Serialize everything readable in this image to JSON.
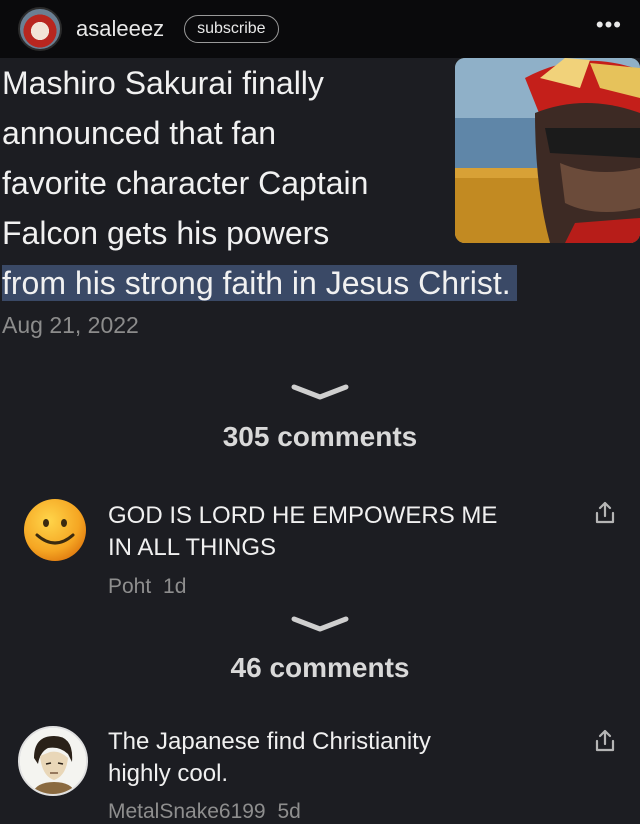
{
  "header": {
    "username": "asaleeez",
    "subscribe_label": "subscribe",
    "more_label": "•••"
  },
  "post": {
    "lines": [
      "Mashiro Sakurai finally",
      "announced that fan",
      "favorite character Captain",
      "Falcon gets his powers",
      "from his strong faith in Jesus Christ."
    ],
    "date": "Aug 21, 2022"
  },
  "threads": [
    {
      "count_label": "305 comments",
      "comment": {
        "lines": [
          "GOD IS LORD HE EMPOWERS ME",
          "IN ALL THINGS"
        ],
        "author": "Poht",
        "age": "1d"
      }
    },
    {
      "count_label": "46 comments",
      "comment": {
        "lines": [
          "The Japanese find Christianity",
          "highly cool."
        ],
        "author": "MetalSnake6199",
        "age": "5d"
      }
    }
  ],
  "colors": {
    "background": "#1c1d22",
    "topbar": "#0a0a0c",
    "highlight": "#3a4966",
    "muted_text": "#8c8c8c"
  }
}
